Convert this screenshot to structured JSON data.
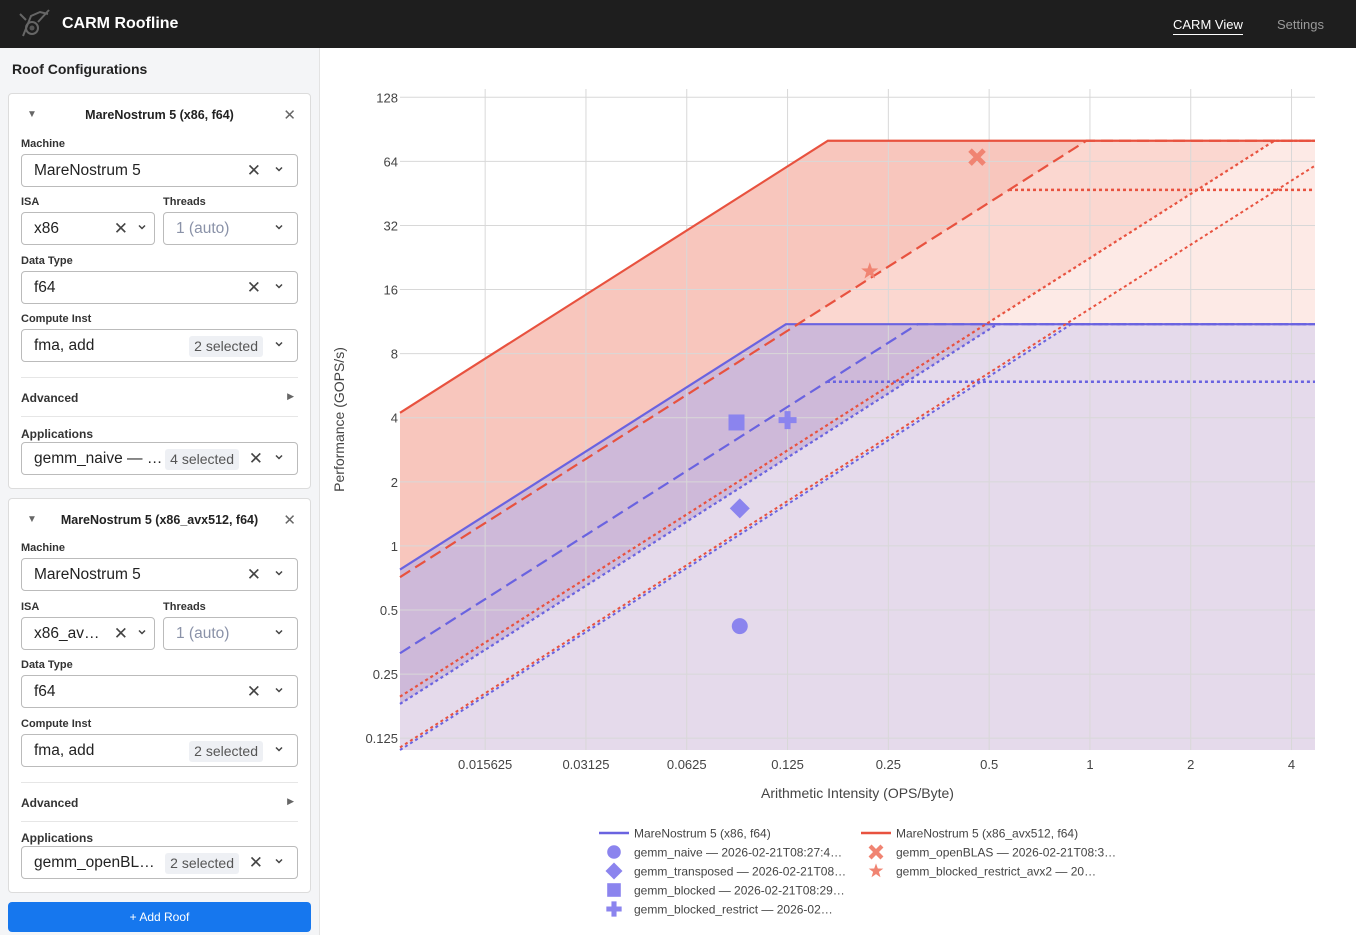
{
  "app": {
    "title": "CARM Roofline"
  },
  "nav": [
    {
      "label": "CARM View",
      "active": true
    },
    {
      "label": "Settings",
      "active": false
    }
  ],
  "sidebar": {
    "title": "Roof Configurations",
    "add_button": "+ Add Roof",
    "cards": [
      {
        "title": "MareNostrum 5 (x86, f64)",
        "machine_label": "Machine",
        "machine": "MareNostrum 5",
        "isa_label": "ISA",
        "isa": "x86",
        "threads_label": "Threads",
        "threads_placeholder": "1 (auto)",
        "dtype_label": "Data Type",
        "dtype": "f64",
        "compute_label": "Compute Inst",
        "compute": "fma, add",
        "compute_badge": "2 selected",
        "advanced_label": "Advanced",
        "apps_label": "Applications",
        "apps": "gemm_naive — …",
        "apps_badge": "4 selected"
      },
      {
        "title": "MareNostrum 5 (x86_avx512, f64)",
        "machine_label": "Machine",
        "machine": "MareNostrum 5",
        "isa_label": "ISA",
        "isa": "x86_av…",
        "threads_label": "Threads",
        "threads_placeholder": "1 (auto)",
        "dtype_label": "Data Type",
        "dtype": "f64",
        "compute_label": "Compute Inst",
        "compute": "fma, add",
        "compute_badge": "2 selected",
        "advanced_label": "Advanced",
        "apps_label": "Applications",
        "apps": "gemm_openBL…",
        "apps_badge": "2 selected"
      }
    ]
  },
  "icons": {
    "toggle": "collapse-triangle-icon",
    "close": "close-icon",
    "clear": "clear-icon",
    "chevron": "chevron-down-icon",
    "arrow": "expand-arrow-icon"
  },
  "colors": {
    "roof1": "#6a63e0",
    "roof2": "#e8523f",
    "roof1_fill": "#ece4f0",
    "roof2_fill": "#f8c6bd",
    "purple_fill": "#c9b6d9",
    "axis_text": "#444"
  },
  "chart_data": {
    "type": "scatter",
    "subtype": "roofline",
    "xlabel": "Arithmetic Intensity (OPS/Byte)",
    "ylabel": "Performance (GOPS/s)",
    "xscale": "log2",
    "yscale": "log2",
    "xlim": [
      0.0087,
      4.7
    ],
    "ylim": [
      0.11,
      140
    ],
    "xticks": [
      0.015625,
      0.03125,
      0.0625,
      0.125,
      0.25,
      0.5,
      1,
      2,
      4
    ],
    "xtick_labels": [
      "0.015625",
      "0.03125",
      "0.0625",
      "0.125",
      "0.25",
      "0.5",
      "1",
      "2",
      "4"
    ],
    "yticks": [
      0.125,
      0.25,
      0.5,
      1,
      2,
      4,
      8,
      16,
      32,
      64,
      128
    ],
    "ytick_labels": [
      "0.125",
      "0.25",
      "0.5",
      "1",
      "2",
      "4",
      "8",
      "16",
      "32",
      "64",
      "128"
    ],
    "grid": true,
    "legend_placement": "bottom",
    "roofs": [
      {
        "name": "MareNostrum 5 (x86, f64)",
        "color": "#6a63e0",
        "peak": 11,
        "secondary_peak": 5.9,
        "bandwidths": [
          {
            "bw": 89,
            "dash": "solid"
          },
          {
            "bw": 36,
            "dash": "dash"
          },
          {
            "bw": 20.8,
            "dash": "dot"
          },
          {
            "bw": 12.5,
            "dash": "dot"
          }
        ]
      },
      {
        "name": "MareNostrum 5 (x86_avx512, f64)",
        "color": "#e8523f",
        "peak": 80,
        "secondary_peak": 47,
        "bandwidths": [
          {
            "bw": 485,
            "dash": "solid"
          },
          {
            "bw": 82,
            "dash": "dash"
          },
          {
            "bw": 22.5,
            "dash": "dot"
          },
          {
            "bw": 13,
            "dash": "dot"
          }
        ]
      }
    ],
    "series": [
      {
        "name": "gemm_naive — 2026-02-21T08:27:4…",
        "color": "#8b84ee",
        "marker": "circle",
        "x": 0.09,
        "y": 0.42
      },
      {
        "name": "gemm_transposed — 2026-02-21T08…",
        "color": "#8b84ee",
        "marker": "diamond",
        "x": 0.09,
        "y": 1.5
      },
      {
        "name": "gemm_blocked — 2026-02-21T08:29…",
        "color": "#8b84ee",
        "marker": "square",
        "x": 0.088,
        "y": 3.8
      },
      {
        "name": "gemm_blocked_restrict — 2026-02…",
        "color": "#8b84ee",
        "marker": "cross",
        "x": 0.125,
        "y": 3.9
      },
      {
        "name": "gemm_openBLAS — 2026-02-21T08:3…",
        "color": "#f08472",
        "marker": "x",
        "x": 0.46,
        "y": 67
      },
      {
        "name": "gemm_blocked_restrict_avx2 — 20…",
        "color": "#f08472",
        "marker": "star",
        "x": 0.22,
        "y": 19.5
      }
    ]
  }
}
